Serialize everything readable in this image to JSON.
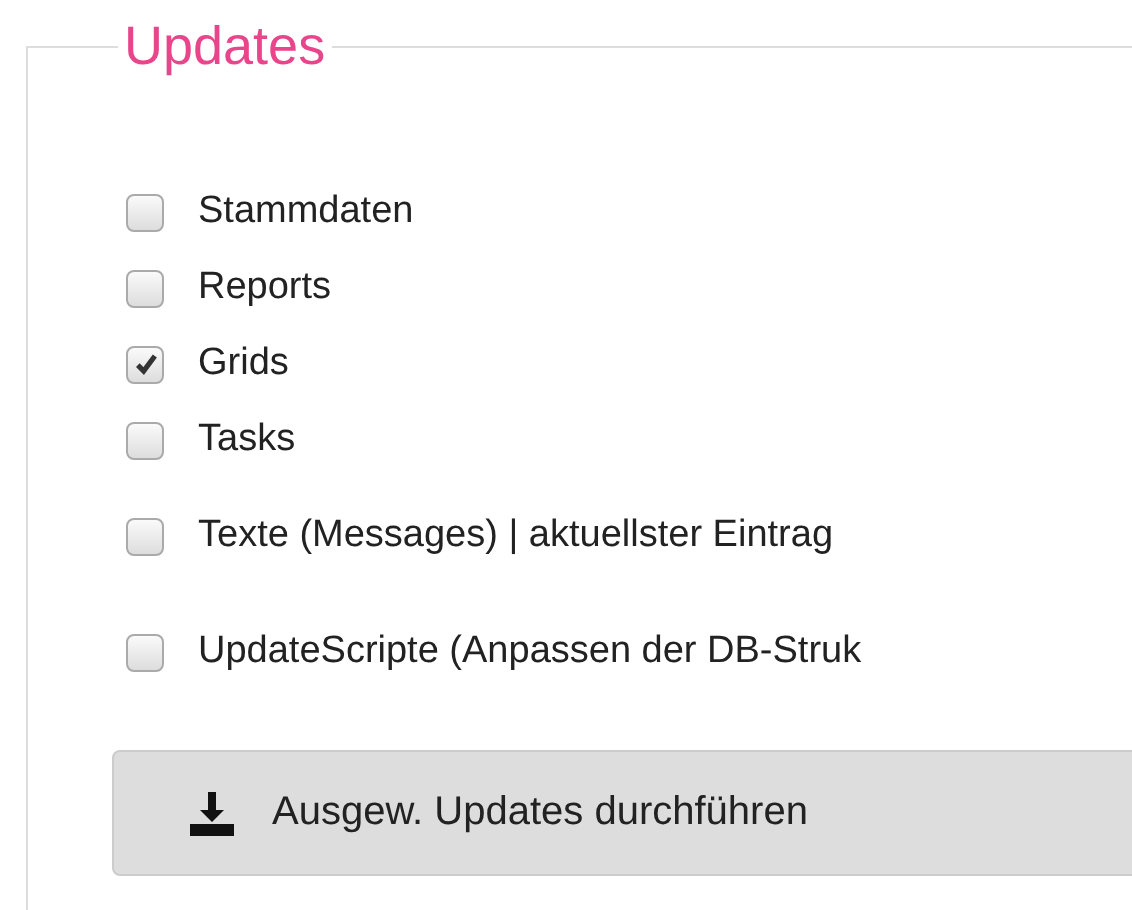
{
  "panel": {
    "title": "Updates",
    "options": [
      {
        "label": "Stammdaten",
        "checked": false
      },
      {
        "label": "Reports",
        "checked": false
      },
      {
        "label": "Grids",
        "checked": true
      },
      {
        "label": "Tasks",
        "checked": false
      },
      {
        "label": "Texte (Messages) | aktuellster Eintrag",
        "checked": false,
        "kind": "spaced"
      },
      {
        "label": "UpdateScripte (Anpassen der DB-Struk",
        "checked": false,
        "kind": "spaced"
      }
    ],
    "button": {
      "label": "Ausgew. Updates durchführen"
    }
  }
}
